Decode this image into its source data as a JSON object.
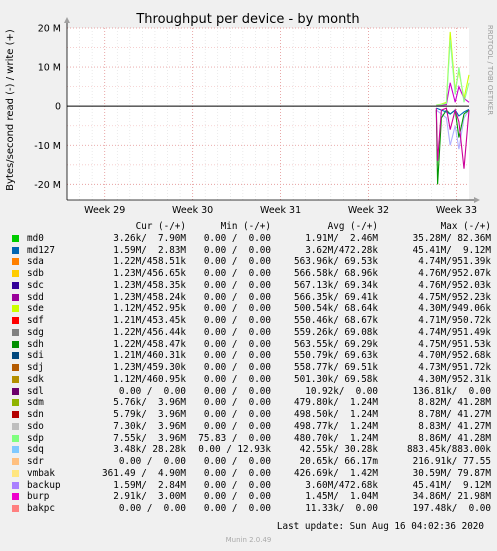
{
  "chart_data": {
    "type": "line",
    "title": "Throughput per device - by month",
    "ylabel": "Bytes/second read (-) / write (+)",
    "side_label": "RRDTOOL / TOBI OETIKER",
    "ylim": [
      -24000000,
      20000000
    ],
    "yticks": [
      {
        "value": 20000000,
        "label": "20 M"
      },
      {
        "value": 10000000,
        "label": "10 M"
      },
      {
        "value": 0,
        "label": "0"
      },
      {
        "value": -10000000,
        "label": "-10 M"
      },
      {
        "value": -20000000,
        "label": "-20 M"
      }
    ],
    "x_range_days": [
      0,
      32
    ],
    "xticks": [
      {
        "value": 3.0,
        "label": "Week 29"
      },
      {
        "value": 10.0,
        "label": "Week 30"
      },
      {
        "value": 17.0,
        "label": "Week 31"
      },
      {
        "value": 24.0,
        "label": "Week 32"
      },
      {
        "value": 31.0,
        "label": "Week 33"
      }
    ],
    "grid": true,
    "series": [
      {
        "name": "sdm",
        "color": "#ccff00",
        "x": [
          29.4,
          29.8,
          30.2,
          30.5,
          30.9,
          31.2,
          31.6,
          32.0
        ],
        "values": [
          300000,
          500000,
          1000000,
          19000000,
          4000000,
          9000000,
          2000000,
          8000000
        ]
      },
      {
        "name": "sdd",
        "color": "#cc00cc",
        "x": [
          29.4,
          29.8,
          30.2,
          30.5,
          30.9,
          31.2,
          31.6,
          32.0
        ],
        "values": [
          200000,
          300000,
          400000,
          6000000,
          1000000,
          5000000,
          2000000,
          1000000
        ]
      },
      {
        "name": "sdp",
        "color": "#8fff8f",
        "x": [
          29.4,
          29.8,
          30.2,
          30.5,
          30.9,
          31.2,
          31.6,
          32.0
        ],
        "values": [
          300000,
          400000,
          700000,
          17000000,
          3000000,
          10000000,
          1000000,
          6000000
        ]
      },
      {
        "name": "sdo",
        "color": "#b0b0ff",
        "x": [
          29.4,
          29.8,
          30.2,
          30.5,
          30.9,
          31.2,
          31.6,
          32.0
        ],
        "values": [
          -1000000,
          -2000000,
          -3000000,
          -10000000,
          -5000000,
          -11000000,
          -3000000,
          -1000000
        ]
      },
      {
        "name": "sdg",
        "color": "#009900",
        "x": [
          29.4,
          29.5,
          29.8,
          30.2,
          30.5,
          30.9,
          31.2,
          31.6,
          32.0
        ],
        "values": [
          -1000000,
          -20000000,
          -3000000,
          -1000000,
          -2000000,
          -1000000,
          -8000000,
          -2000000,
          -1000000
        ]
      },
      {
        "name": "sdc",
        "color": "#0066b3",
        "x": [
          29.4,
          29.8,
          30.2,
          30.5,
          30.9,
          31.2,
          31.6,
          32.0
        ],
        "values": [
          -500000,
          -1000000,
          -1500000,
          -2000000,
          -1000000,
          -2500000,
          -1500000,
          -800000
        ]
      },
      {
        "name": "burp",
        "color": "#cc0099",
        "x": [
          29.4,
          29.5,
          29.8,
          30.2,
          30.5,
          30.9,
          31.2,
          31.6,
          32.0
        ],
        "values": [
          -500000,
          -14000000,
          -1000000,
          -500000,
          -6000000,
          -1000000,
          -4000000,
          -16000000,
          -1000000
        ]
      }
    ],
    "legend": {
      "headers": {
        "cur": "Cur (-/+)",
        "min": "Min (-/+)",
        "avg": "Avg (-/+)",
        "max": "Max (-/+)"
      },
      "rows": [
        {
          "name": "md0",
          "color": "#00cc00",
          "cur": "3.26k/  7.90M",
          "min": "0.00 /  0.00",
          "avg": "1.91M/  2.46M",
          "max": "35.28M/ 82.36M"
        },
        {
          "name": "md127",
          "color": "#0066b3",
          "cur": "1.59M/  2.83M",
          "min": "0.00 /  0.00",
          "avg": "3.62M/472.28k",
          "max": "45.41M/  9.12M"
        },
        {
          "name": "sda",
          "color": "#ff8000",
          "cur": "1.22M/458.51k",
          "min": "0.00 /  0.00",
          "avg": "563.96k/ 69.53k",
          "max": "4.74M/951.39k"
        },
        {
          "name": "sdb",
          "color": "#ffcc00",
          "cur": "1.23M/456.65k",
          "min": "0.00 /  0.00",
          "avg": "566.58k/ 68.96k",
          "max": "4.76M/952.07k"
        },
        {
          "name": "sdc",
          "color": "#330099",
          "cur": "1.23M/458.35k",
          "min": "0.00 /  0.00",
          "avg": "567.13k/ 69.34k",
          "max": "4.76M/952.03k"
        },
        {
          "name": "sdd",
          "color": "#990099",
          "cur": "1.23M/458.24k",
          "min": "0.00 /  0.00",
          "avg": "566.35k/ 69.41k",
          "max": "4.75M/952.23k"
        },
        {
          "name": "sde",
          "color": "#ccff00",
          "cur": "1.12M/452.95k",
          "min": "0.00 /  0.00",
          "avg": "500.54k/ 68.64k",
          "max": "4.30M/949.06k"
        },
        {
          "name": "sdf",
          "color": "#ff0000",
          "cur": "1.21M/453.45k",
          "min": "0.00 /  0.00",
          "avg": "550.46k/ 68.67k",
          "max": "4.71M/950.72k"
        },
        {
          "name": "sdg",
          "color": "#808080",
          "cur": "1.22M/456.44k",
          "min": "0.00 /  0.00",
          "avg": "559.26k/ 69.08k",
          "max": "4.74M/951.49k"
        },
        {
          "name": "sdh",
          "color": "#008f00",
          "cur": "1.22M/458.47k",
          "min": "0.00 /  0.00",
          "avg": "563.55k/ 69.29k",
          "max": "4.75M/951.53k"
        },
        {
          "name": "sdi",
          "color": "#00487d",
          "cur": "1.21M/460.31k",
          "min": "0.00 /  0.00",
          "avg": "550.79k/ 69.63k",
          "max": "4.70M/952.68k"
        },
        {
          "name": "sdj",
          "color": "#b35a00",
          "cur": "1.23M/459.30k",
          "min": "0.00 /  0.00",
          "avg": "558.77k/ 69.51k",
          "max": "4.73M/951.72k"
        },
        {
          "name": "sdk",
          "color": "#b38f00",
          "cur": "1.12M/460.95k",
          "min": "0.00 /  0.00",
          "avg": "501.30k/ 69.58k",
          "max": "4.30M/952.31k"
        },
        {
          "name": "sdl",
          "color": "#6b006b",
          "cur": "0.00 /  0.00",
          "min": "0.00 /  0.00",
          "avg": "10.92k/  0.00",
          "max": "136.81k/  0.00"
        },
        {
          "name": "sdm",
          "color": "#8fb300",
          "cur": "5.76k/  3.96M",
          "min": "0.00 /  0.00",
          "avg": "479.80k/  1.24M",
          "max": "8.82M/ 41.28M"
        },
        {
          "name": "sdn",
          "color": "#b30000",
          "cur": "5.79k/  3.96M",
          "min": "0.00 /  0.00",
          "avg": "498.50k/  1.24M",
          "max": "8.78M/ 41.27M"
        },
        {
          "name": "sdo",
          "color": "#bebebe",
          "cur": "7.30k/  3.96M",
          "min": "0.00 /  0.00",
          "avg": "498.77k/  1.24M",
          "max": "8.83M/ 41.27M"
        },
        {
          "name": "sdp",
          "color": "#80ff80",
          "cur": "7.55k/  3.96M",
          "min": "75.83 /  0.00",
          "avg": "480.70k/  1.24M",
          "max": "8.86M/ 41.28M"
        },
        {
          "name": "sdq",
          "color": "#80c9ff",
          "cur": "3.48k/ 28.28k",
          "min": "0.00 / 12.93k",
          "avg": "42.55k/ 30.28k",
          "max": "883.45k/883.00k"
        },
        {
          "name": "sdr",
          "color": "#ffc080",
          "cur": "0.00 /  0.00",
          "min": "0.00 /  0.00",
          "avg": "20.65k/ 66.17m",
          "max": "216.91k/ 77.55"
        },
        {
          "name": "vmbak",
          "color": "#ffe680",
          "cur": "361.49 /  4.90M",
          "min": "0.00 /  0.00",
          "avg": "426.69k/  1.42M",
          "max": "30.59M/ 79.87M"
        },
        {
          "name": "backup",
          "color": "#aa80ff",
          "cur": "1.59M/  2.84M",
          "min": "0.00 /  0.00",
          "avg": "3.60M/472.68k",
          "max": "45.41M/  9.12M"
        },
        {
          "name": "burp",
          "color": "#ee00cc",
          "cur": "2.91k/  3.00M",
          "min": "0.00 /  0.00",
          "avg": "1.45M/  1.04M",
          "max": "34.86M/ 21.98M"
        },
        {
          "name": "bakpc",
          "color": "#ff8080",
          "cur": "0.00 /  0.00",
          "min": "0.00 /  0.00",
          "avg": "11.33k/  0.00",
          "max": "197.48k/  0.00"
        }
      ]
    }
  },
  "footer": {
    "last_update": "Last update: Sun Aug 16 04:02:36 2020",
    "version": "Munin 2.0.49"
  }
}
